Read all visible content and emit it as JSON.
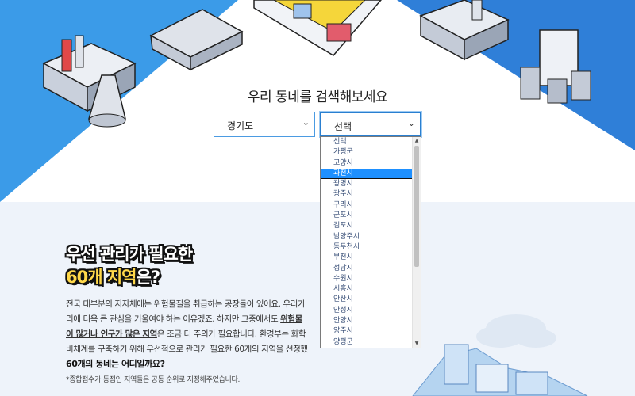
{
  "search": {
    "title": "우리 동네를 검색해보세요",
    "province_value": "경기도",
    "city_value": "선택",
    "chevron": "⌄"
  },
  "dropdown": {
    "options": [
      "선택",
      "가평군",
      "고양시",
      "과천시",
      "광명시",
      "광주시",
      "구리시",
      "군포시",
      "김포시",
      "남양주시",
      "동두천시",
      "부천시",
      "성남시",
      "수원시",
      "시흥시",
      "안산시",
      "안성시",
      "안양시",
      "양주시",
      "양평군"
    ],
    "selected_index": 3
  },
  "headline": {
    "line1": "우선 관리가 필요한",
    "line2_highlight": "60개 지역",
    "line2_rest": "은?"
  },
  "body": {
    "line1": "전국 대부분의 지자체에는 위험물질을 취급하는 공장들이 있어요. 우리가",
    "line2_a": "리에 더욱 큰 관심을 기울여야 하는 이유겠죠. 하지만 그중에서도 ",
    "line2_b": "위험물",
    "line3_a": "이 많거나 ",
    "line3_b": "인구가 많은 지역",
    "line3_c": "은 조금 더 주의가 필요합니다. 환경부는 화학",
    "line4": "비체계를 구축하기 위해 우선적으로 관리가 필요한 60개의 지역을 선정했"
  },
  "subhead": "60개의 동네는 어디일까요?",
  "note": "*종합점수가 동점인 지역들은 공동 순위로 지정해주었습니다.",
  "colors": {
    "sky_left": "#3b9be8",
    "sky_right": "#2f7fd8",
    "select_border": "#4b9be2",
    "dropdown_highlight": "#1e90ff",
    "headline_highlight": "#ffd84a",
    "lower_bg": "#eef3fa"
  },
  "icons": [
    "factory-illustration",
    "warehouse-illustration",
    "town-illustration",
    "plant-illustration",
    "tanks-illustration",
    "building-illustration",
    "cloud-illustration",
    "chevron-down-icon"
  ]
}
